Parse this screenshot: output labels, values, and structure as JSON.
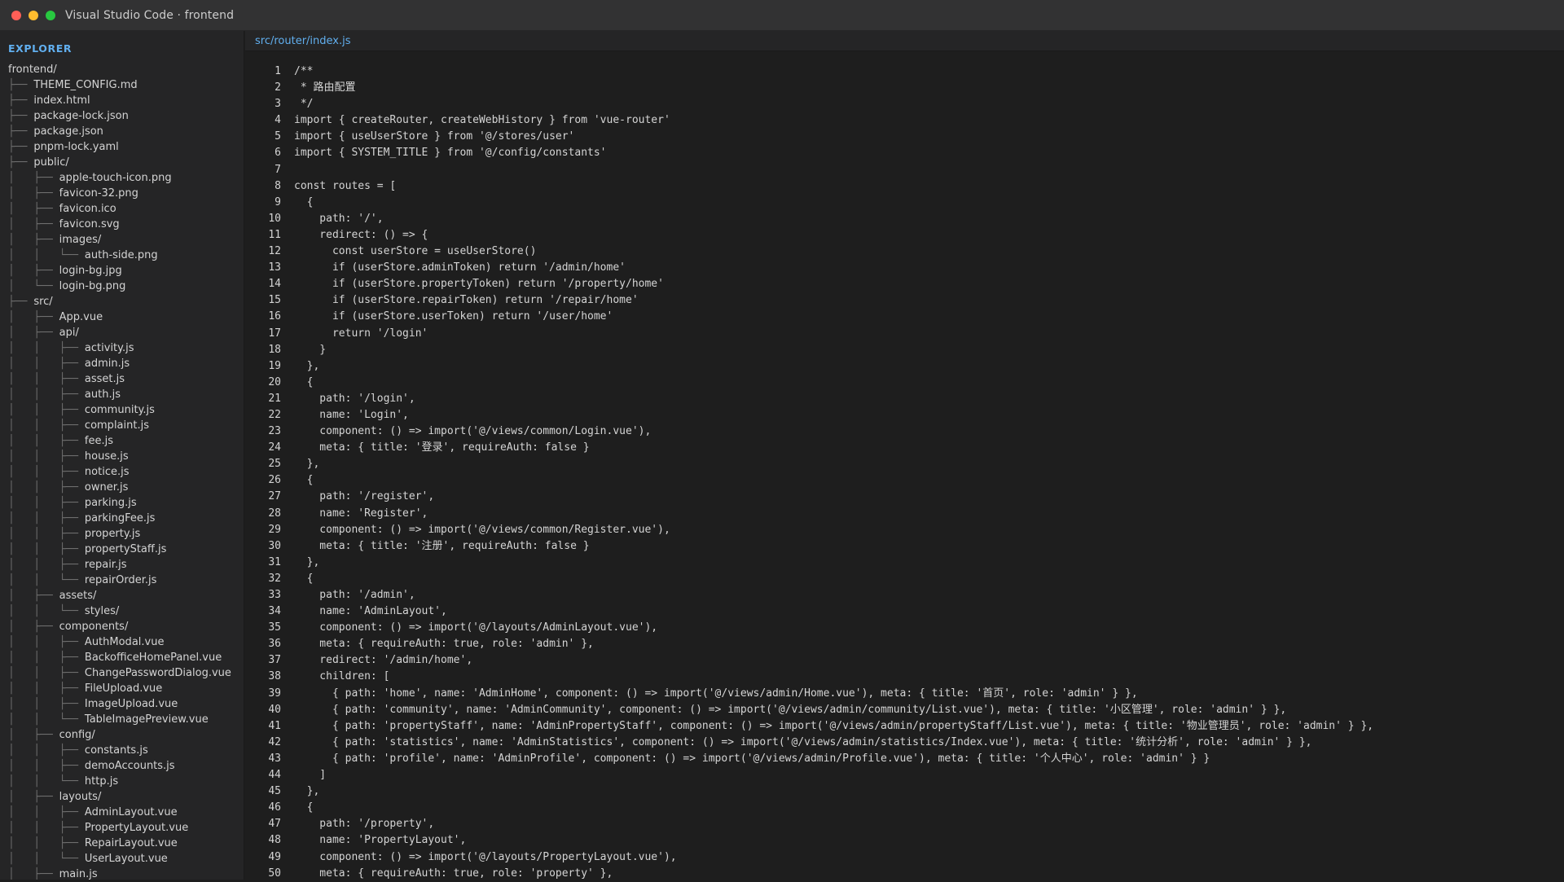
{
  "window": {
    "title": "Visual Studio Code · frontend",
    "traffic_colors": [
      "#ff5f57",
      "#febc2e",
      "#28c840"
    ]
  },
  "sidebar": {
    "title": "EXPLORER",
    "items": [
      {
        "prefix": "",
        "name": "frontend/"
      },
      {
        "prefix": "├── ",
        "name": "THEME_CONFIG.md"
      },
      {
        "prefix": "├── ",
        "name": "index.html"
      },
      {
        "prefix": "├── ",
        "name": "package-lock.json"
      },
      {
        "prefix": "├── ",
        "name": "package.json"
      },
      {
        "prefix": "├── ",
        "name": "pnpm-lock.yaml"
      },
      {
        "prefix": "├── ",
        "name": "public/"
      },
      {
        "prefix": "│   ├── ",
        "name": "apple-touch-icon.png"
      },
      {
        "prefix": "│   ├── ",
        "name": "favicon-32.png"
      },
      {
        "prefix": "│   ├── ",
        "name": "favicon.ico"
      },
      {
        "prefix": "│   ├── ",
        "name": "favicon.svg"
      },
      {
        "prefix": "│   ├── ",
        "name": "images/"
      },
      {
        "prefix": "│   │   └── ",
        "name": "auth-side.png"
      },
      {
        "prefix": "│   ├── ",
        "name": "login-bg.jpg"
      },
      {
        "prefix": "│   └── ",
        "name": "login-bg.png"
      },
      {
        "prefix": "├── ",
        "name": "src/"
      },
      {
        "prefix": "│   ├── ",
        "name": "App.vue"
      },
      {
        "prefix": "│   ├── ",
        "name": "api/"
      },
      {
        "prefix": "│   │   ├── ",
        "name": "activity.js"
      },
      {
        "prefix": "│   │   ├── ",
        "name": "admin.js"
      },
      {
        "prefix": "│   │   ├── ",
        "name": "asset.js"
      },
      {
        "prefix": "│   │   ├── ",
        "name": "auth.js"
      },
      {
        "prefix": "│   │   ├── ",
        "name": "community.js"
      },
      {
        "prefix": "│   │   ├── ",
        "name": "complaint.js"
      },
      {
        "prefix": "│   │   ├── ",
        "name": "fee.js"
      },
      {
        "prefix": "│   │   ├── ",
        "name": "house.js"
      },
      {
        "prefix": "│   │   ├── ",
        "name": "notice.js"
      },
      {
        "prefix": "│   │   ├── ",
        "name": "owner.js"
      },
      {
        "prefix": "│   │   ├── ",
        "name": "parking.js"
      },
      {
        "prefix": "│   │   ├── ",
        "name": "parkingFee.js"
      },
      {
        "prefix": "│   │   ├── ",
        "name": "property.js"
      },
      {
        "prefix": "│   │   ├── ",
        "name": "propertyStaff.js"
      },
      {
        "prefix": "│   │   ├── ",
        "name": "repair.js"
      },
      {
        "prefix": "│   │   └── ",
        "name": "repairOrder.js"
      },
      {
        "prefix": "│   ├── ",
        "name": "assets/"
      },
      {
        "prefix": "│   │   └── ",
        "name": "styles/"
      },
      {
        "prefix": "│   ├── ",
        "name": "components/"
      },
      {
        "prefix": "│   │   ├── ",
        "name": "AuthModal.vue"
      },
      {
        "prefix": "│   │   ├── ",
        "name": "BackofficeHomePanel.vue"
      },
      {
        "prefix": "│   │   ├── ",
        "name": "ChangePasswordDialog.vue"
      },
      {
        "prefix": "│   │   ├── ",
        "name": "FileUpload.vue"
      },
      {
        "prefix": "│   │   ├── ",
        "name": "ImageUpload.vue"
      },
      {
        "prefix": "│   │   └── ",
        "name": "TableImagePreview.vue"
      },
      {
        "prefix": "│   ├── ",
        "name": "config/"
      },
      {
        "prefix": "│   │   ├── ",
        "name": "constants.js"
      },
      {
        "prefix": "│   │   ├── ",
        "name": "demoAccounts.js"
      },
      {
        "prefix": "│   │   └── ",
        "name": "http.js"
      },
      {
        "prefix": "│   ├── ",
        "name": "layouts/"
      },
      {
        "prefix": "│   │   ├── ",
        "name": "AdminLayout.vue"
      },
      {
        "prefix": "│   │   ├── ",
        "name": "PropertyLayout.vue"
      },
      {
        "prefix": "│   │   ├── ",
        "name": "RepairLayout.vue"
      },
      {
        "prefix": "│   │   └── ",
        "name": "UserLayout.vue"
      },
      {
        "prefix": "│   ├── ",
        "name": "main.js"
      }
    ]
  },
  "editor": {
    "tab_label": "src/router/index.js",
    "lines": [
      {
        "n": "1",
        "text": "/**"
      },
      {
        "n": "2",
        "text": " * 路由配置"
      },
      {
        "n": "3",
        "text": " */"
      },
      {
        "n": "4",
        "text": "import { createRouter, createWebHistory } from 'vue-router'"
      },
      {
        "n": "5",
        "text": "import { useUserStore } from '@/stores/user'"
      },
      {
        "n": "6",
        "text": "import { SYSTEM_TITLE } from '@/config/constants'"
      },
      {
        "n": "7",
        "text": ""
      },
      {
        "n": "8",
        "text": "const routes = ["
      },
      {
        "n": "9",
        "text": "  {"
      },
      {
        "n": "10",
        "text": "    path: '/',"
      },
      {
        "n": "11",
        "text": "    redirect: () => {"
      },
      {
        "n": "12",
        "text": "      const userStore = useUserStore()"
      },
      {
        "n": "13",
        "text": "      if (userStore.adminToken) return '/admin/home'"
      },
      {
        "n": "14",
        "text": "      if (userStore.propertyToken) return '/property/home'"
      },
      {
        "n": "15",
        "text": "      if (userStore.repairToken) return '/repair/home'"
      },
      {
        "n": "16",
        "text": "      if (userStore.userToken) return '/user/home'"
      },
      {
        "n": "17",
        "text": "      return '/login'"
      },
      {
        "n": "18",
        "text": "    }"
      },
      {
        "n": "19",
        "text": "  },"
      },
      {
        "n": "20",
        "text": "  {"
      },
      {
        "n": "21",
        "text": "    path: '/login',"
      },
      {
        "n": "22",
        "text": "    name: 'Login',"
      },
      {
        "n": "23",
        "text": "    component: () => import('@/views/common/Login.vue'),"
      },
      {
        "n": "24",
        "text": "    meta: { title: '登录', requireAuth: false }"
      },
      {
        "n": "25",
        "text": "  },"
      },
      {
        "n": "26",
        "text": "  {"
      },
      {
        "n": "27",
        "text": "    path: '/register',"
      },
      {
        "n": "28",
        "text": "    name: 'Register',"
      },
      {
        "n": "29",
        "text": "    component: () => import('@/views/common/Register.vue'),"
      },
      {
        "n": "30",
        "text": "    meta: { title: '注册', requireAuth: false }"
      },
      {
        "n": "31",
        "text": "  },"
      },
      {
        "n": "32",
        "text": "  {"
      },
      {
        "n": "33",
        "text": "    path: '/admin',"
      },
      {
        "n": "34",
        "text": "    name: 'AdminLayout',"
      },
      {
        "n": "35",
        "text": "    component: () => import('@/layouts/AdminLayout.vue'),"
      },
      {
        "n": "36",
        "text": "    meta: { requireAuth: true, role: 'admin' },"
      },
      {
        "n": "37",
        "text": "    redirect: '/admin/home',"
      },
      {
        "n": "38",
        "text": "    children: ["
      },
      {
        "n": "39",
        "text": "      { path: 'home', name: 'AdminHome', component: () => import('@/views/admin/Home.vue'), meta: { title: '首页', role: 'admin' } },"
      },
      {
        "n": "40",
        "text": "      { path: 'community', name: 'AdminCommunity', component: () => import('@/views/admin/community/List.vue'), meta: { title: '小区管理', role: 'admin' } },"
      },
      {
        "n": "41",
        "text": "      { path: 'propertyStaff', name: 'AdminPropertyStaff', component: () => import('@/views/admin/propertyStaff/List.vue'), meta: { title: '物业管理员', role: 'admin' } },"
      },
      {
        "n": "42",
        "text": "      { path: 'statistics', name: 'AdminStatistics', component: () => import('@/views/admin/statistics/Index.vue'), meta: { title: '统计分析', role: 'admin' } },"
      },
      {
        "n": "43",
        "text": "      { path: 'profile', name: 'AdminProfile', component: () => import('@/views/admin/Profile.vue'), meta: { title: '个人中心', role: 'admin' } }"
      },
      {
        "n": "44",
        "text": "    ]"
      },
      {
        "n": "45",
        "text": "  },"
      },
      {
        "n": "46",
        "text": "  {"
      },
      {
        "n": "47",
        "text": "    path: '/property',"
      },
      {
        "n": "48",
        "text": "    name: 'PropertyLayout',"
      },
      {
        "n": "49",
        "text": "    component: () => import('@/layouts/PropertyLayout.vue'),"
      },
      {
        "n": "50",
        "text": "    meta: { requireAuth: true, role: 'property' },"
      }
    ]
  }
}
